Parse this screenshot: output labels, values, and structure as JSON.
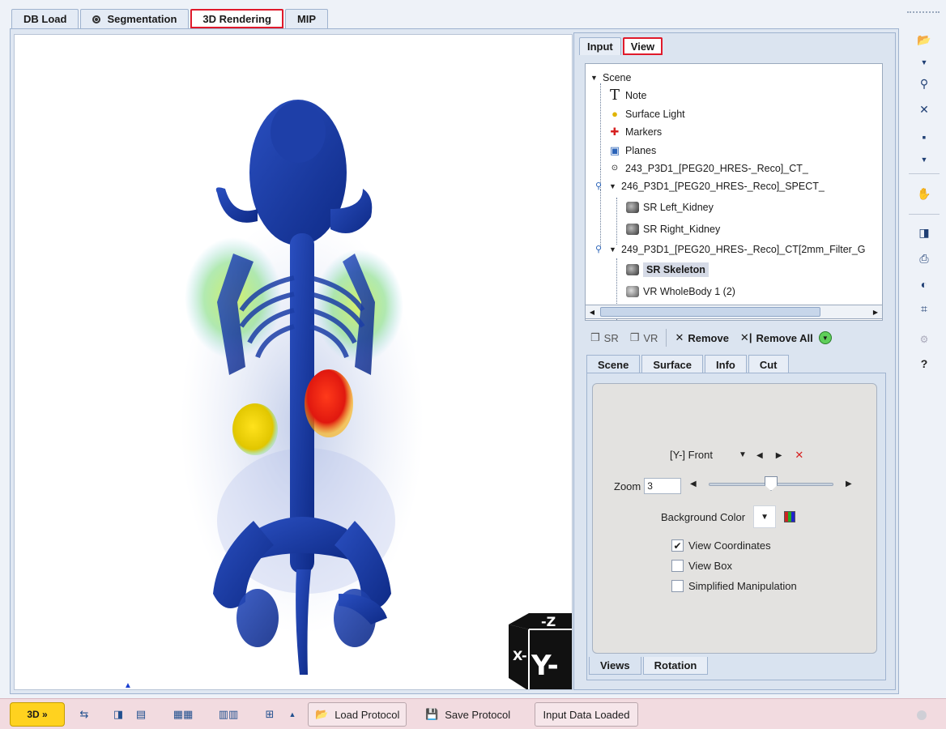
{
  "top_tabs": [
    {
      "label": "DB Load",
      "active": false
    },
    {
      "label": "Segmentation",
      "active": false
    },
    {
      "label": "3D Rendering",
      "active": true
    },
    {
      "label": "MIP",
      "active": false
    }
  ],
  "viewport": {
    "orientation_cube": {
      "front": "Y-",
      "side": "X-",
      "top": "-Z"
    }
  },
  "right_panel": {
    "tabs": [
      {
        "label": "Input"
      },
      {
        "label": "View"
      }
    ],
    "tree": [
      {
        "label": "Scene"
      },
      {
        "label": "Note"
      },
      {
        "label": "Surface Light"
      },
      {
        "label": "Markers"
      },
      {
        "label": "Planes"
      },
      {
        "label": "243_P3D1_[PEG20_HRES-_Reco]_CT_"
      },
      {
        "label": "246_P3D1_[PEG20_HRES-_Reco]_SPECT_"
      },
      {
        "label": "SR Left_Kidney"
      },
      {
        "label": "SR Right_Kidney"
      },
      {
        "label": "249_P3D1_[PEG20_HRES-_Reco]_CT[2mm_Filter_G"
      },
      {
        "label": "SR Skeleton"
      },
      {
        "label": "VR WholeBody 1 (2)"
      }
    ],
    "toolbar": {
      "sr_label": "SR",
      "vr_label": "VR",
      "remove_label": "Remove",
      "remove_all_label": "Remove All"
    },
    "sub_tabs": [
      "Scene",
      "Surface",
      "Info",
      "Cut"
    ],
    "scene": {
      "view_preset": "[Y-] Front",
      "zoom_label": "Zoom",
      "zoom_value": "3",
      "zoom_fraction": 0.5,
      "bg_color_label": "Background Color",
      "checkboxes": [
        {
          "label": "View Coordinates",
          "checked": true
        },
        {
          "label": "View Box",
          "checked": false
        },
        {
          "label": "Simplified Manipulation",
          "checked": false
        }
      ]
    },
    "bottom_tabs": [
      "Views",
      "Rotation"
    ]
  },
  "right_toolbar": {
    "icons": [
      "open-folder-icon",
      "dropdown-icon",
      "pin-icon",
      "close-all-icon",
      "save-icon",
      "dropdown-icon",
      "hand-icon",
      "snapshot-icon",
      "print-icon",
      "contrast-icon",
      "fit-icon",
      "link-icon",
      "help-icon"
    ]
  },
  "bottom_bar": {
    "mode_label": "3D »",
    "load_protocol": "Load Protocol",
    "save_protocol": "Save Protocol",
    "status": "Input Data Loaded"
  },
  "colors": {
    "highlight": "#e01a2b",
    "mode_button": "#ffd21f",
    "bottom_bar": "#f2dbe0"
  }
}
